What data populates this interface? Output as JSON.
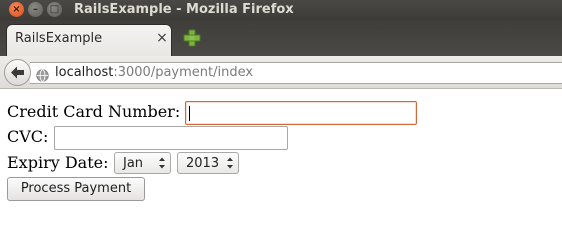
{
  "window": {
    "title": "RailsExample - Mozilla Firefox",
    "controls": {
      "close": "×",
      "minimize": "–",
      "maximize": "□"
    }
  },
  "tabs": [
    {
      "label": "RailsExample",
      "close": "×",
      "active": true
    }
  ],
  "new_tab_icon": "plus-icon",
  "navbar": {
    "back_icon": "back-arrow-icon",
    "site_icon": "globe-icon",
    "url_host": "localhost",
    "url_rest": ":3000/payment/index"
  },
  "form": {
    "card_number_label": "Credit Card Number:",
    "card_number_value": "",
    "cvc_label": "CVC:",
    "cvc_value": "",
    "expiry_label": "Expiry Date:",
    "expiry_month": "Jan",
    "expiry_year": "2013",
    "submit_label": "Process Payment"
  },
  "colors": {
    "titlebar": "#3c3b37",
    "close_button": "#df4a16",
    "focused_field_border": "#cf6a3a",
    "new_tab_plus": "#7cb342"
  }
}
